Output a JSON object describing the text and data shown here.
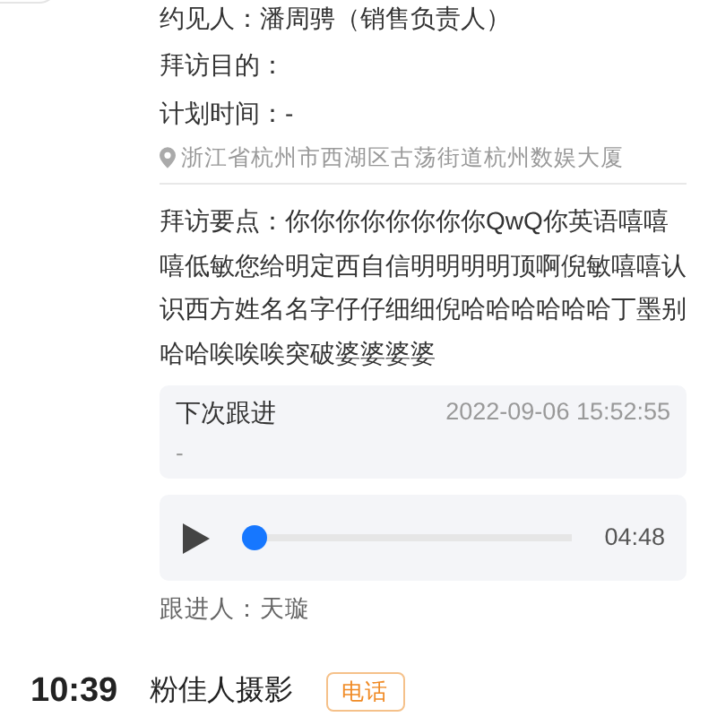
{
  "visit": {
    "contact": "约见人：潘周骋（销售负责人）",
    "purpose": "拜访目的：",
    "plan_time": "计划时间：-",
    "address": "浙江省杭州市西湖区古荡街道杭州数娱大厦",
    "notes": "拜访要点：你你你你你你你你QwQ你英语嘻嘻嘻低敏您给明定西自信明明明明顶啊倪敏嘻嘻认识西方姓名名字仔仔细细倪哈哈哈哈哈哈丁墨别哈哈唉唉唉突破婆婆婆婆"
  },
  "next_followup": {
    "title": "下次跟进",
    "time": "2022-09-06 15:52:55",
    "content": "-"
  },
  "audio": {
    "level": 0,
    "duration": "04:48"
  },
  "follower": "跟进人：天璇",
  "next_entry": {
    "time": "10:39",
    "name": "粉佳人摄影",
    "tag": "电话"
  }
}
